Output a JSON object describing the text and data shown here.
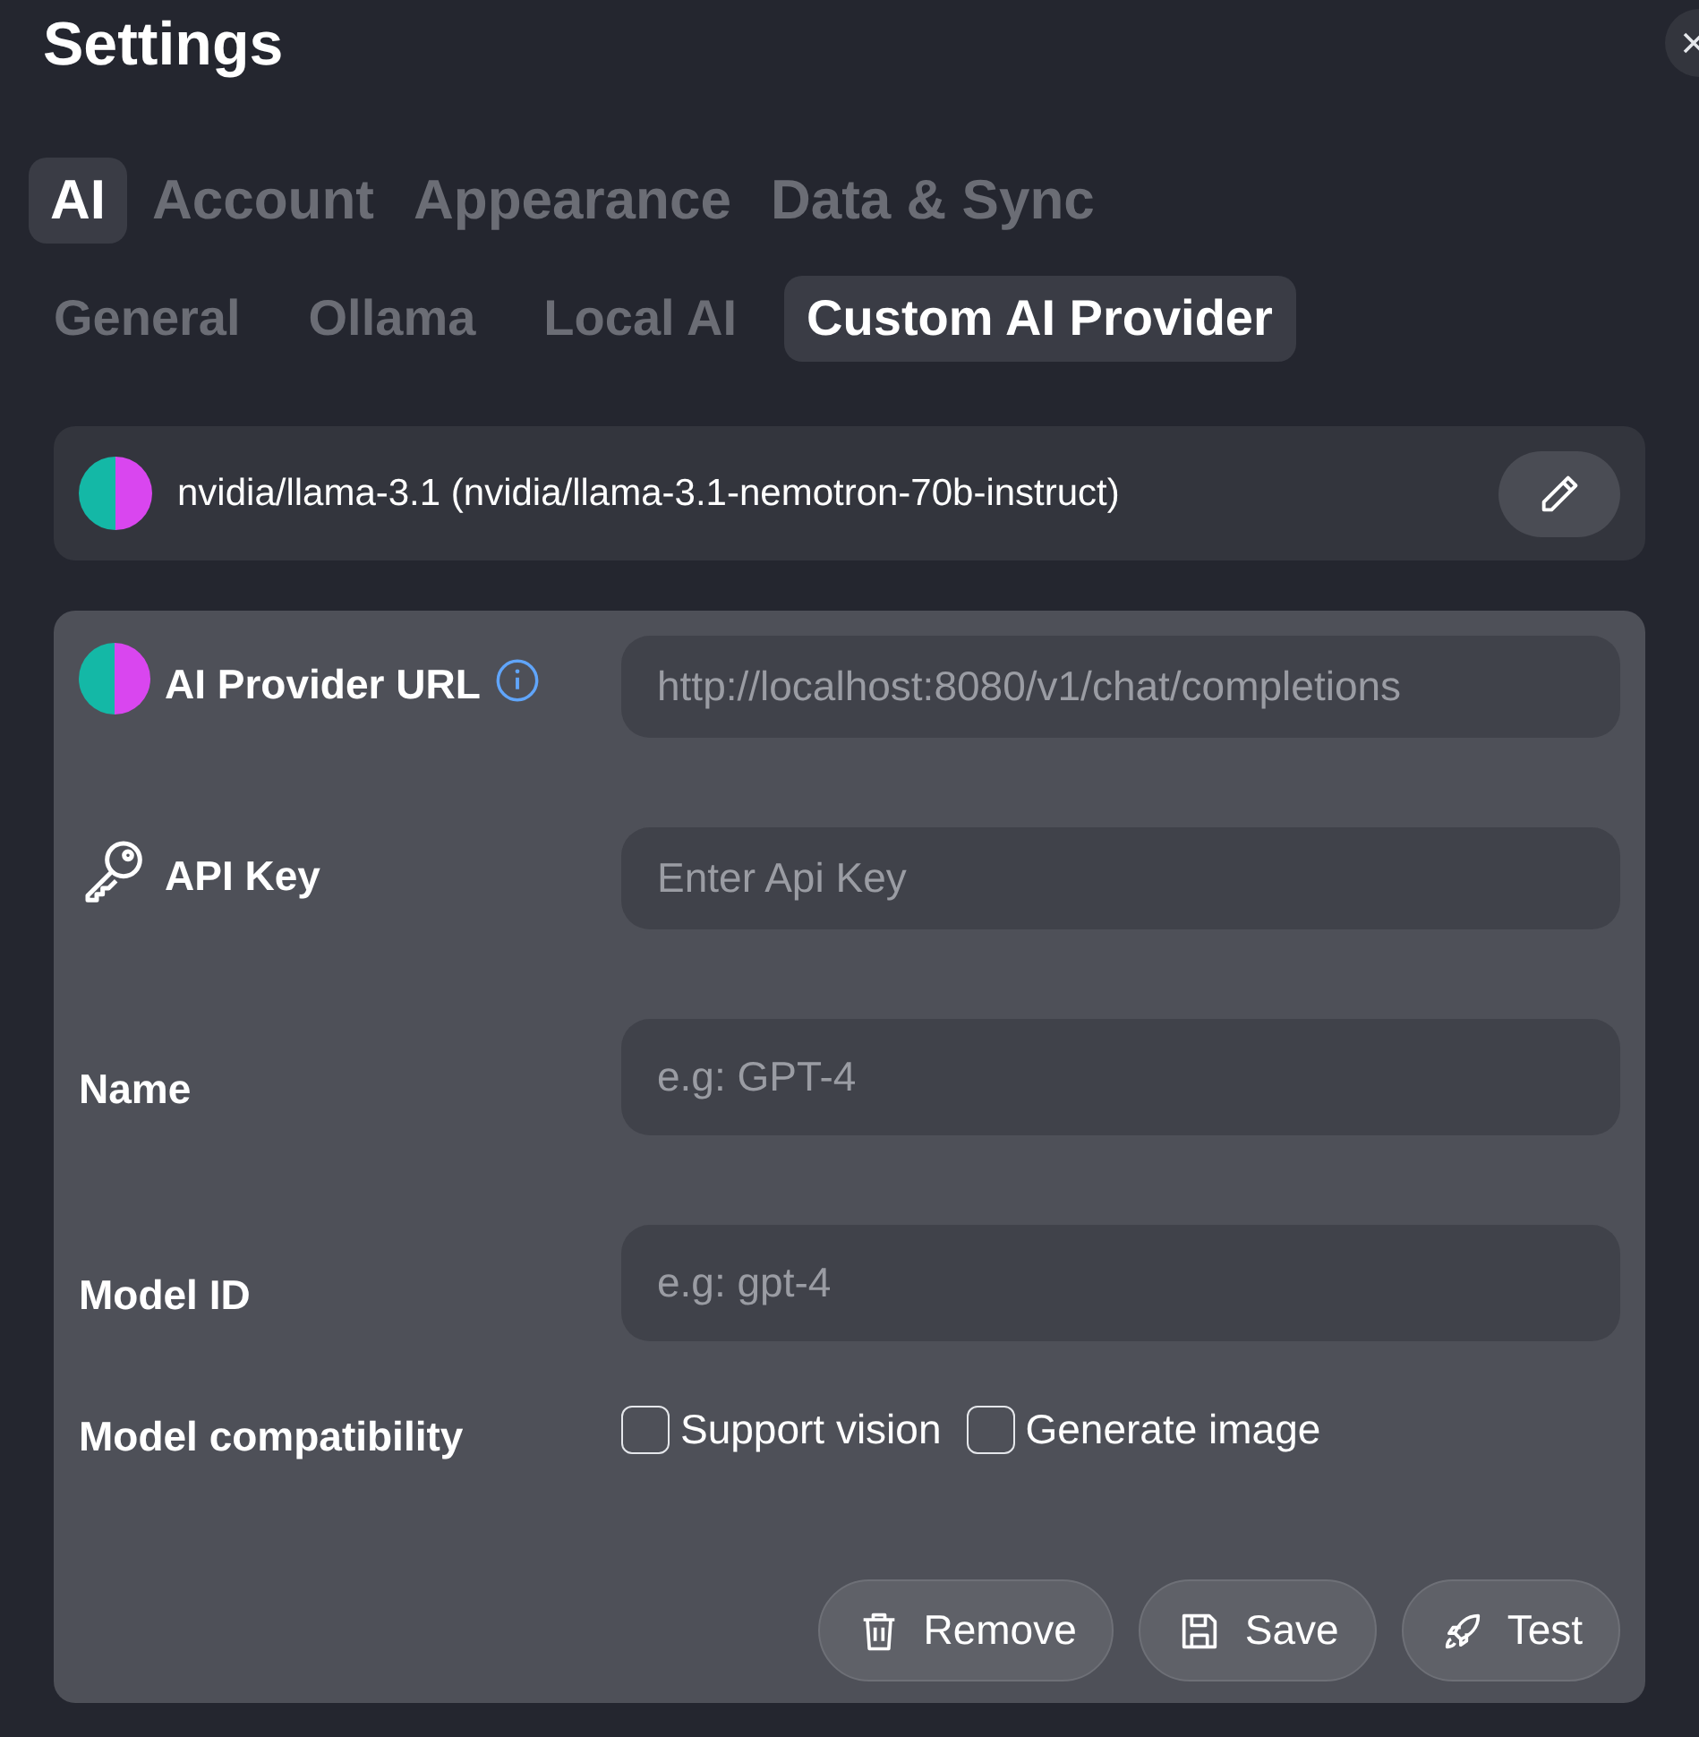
{
  "window": {
    "title": "Settings"
  },
  "tabs": [
    {
      "label": "AI",
      "selected": true
    },
    {
      "label": "Account",
      "selected": false
    },
    {
      "label": "Appearance",
      "selected": false
    },
    {
      "label": "Data & Sync",
      "selected": false
    }
  ],
  "subtabs": [
    {
      "label": "General",
      "selected": false
    },
    {
      "label": "Ollama",
      "selected": false
    },
    {
      "label": "Local AI",
      "selected": false
    },
    {
      "label": "Custom AI Provider",
      "selected": true
    }
  ],
  "current_model": {
    "label": "nvidia/llama-3.1 (nvidia/llama-3.1-nemotron-70b-instruct)"
  },
  "fields": [
    {
      "kind": "brain",
      "label": "AI Provider URL",
      "info": true,
      "placeholder": "http://localhost:8080/v1/chat/completions"
    },
    {
      "kind": "key",
      "label": "API Key",
      "info": false,
      "placeholder": "Enter Api Key"
    },
    {
      "kind": "plain",
      "label": "Name",
      "info": false,
      "placeholder": "e.g: GPT-4"
    },
    {
      "kind": "plain",
      "label": "Model ID",
      "info": false,
      "placeholder": "e.g: gpt-4"
    }
  ],
  "compatibility": {
    "label": "Model compatibility",
    "options": [
      {
        "label": "Support vision",
        "checked": false
      },
      {
        "label": "Generate image",
        "checked": false
      }
    ]
  },
  "buttons": [
    {
      "kind": "remove",
      "label": "Remove"
    },
    {
      "kind": "save",
      "label": "Save"
    },
    {
      "kind": "test",
      "label": "Test"
    }
  ]
}
